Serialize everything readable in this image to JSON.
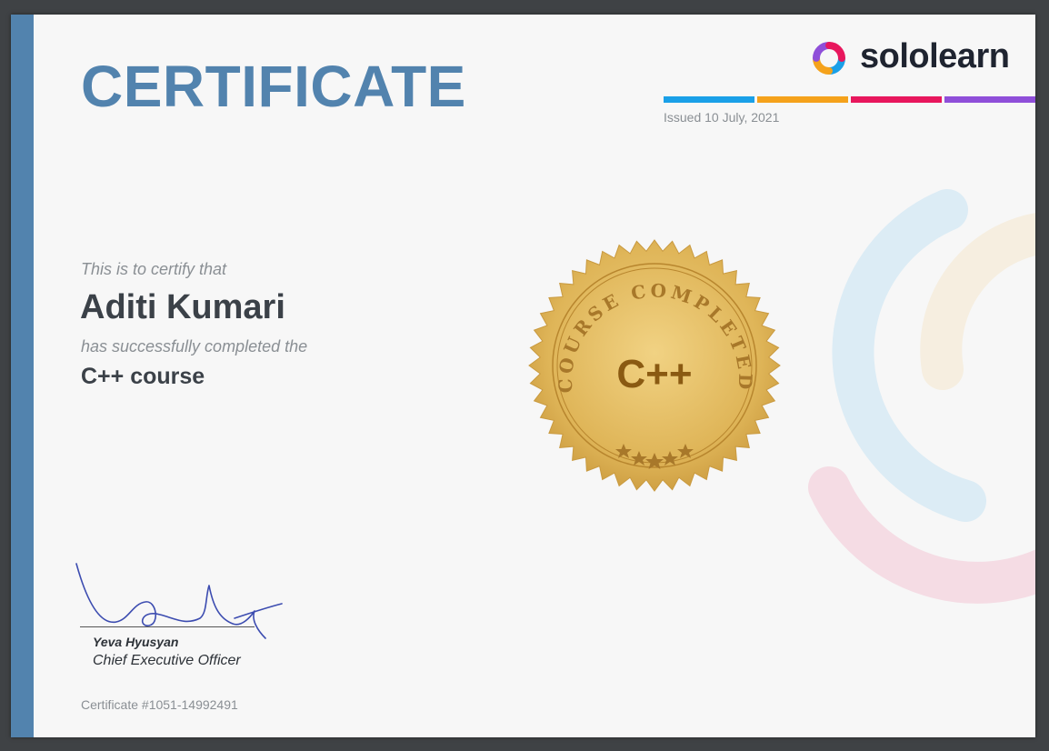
{
  "certificate": {
    "title": "CERTIFICATE",
    "brand": {
      "name": "sololearn",
      "logo_icon": "sololearn-logo-icon",
      "stripe_colors": [
        "#1aa0e8",
        "#f5a21b",
        "#e8175d",
        "#8f4fd9"
      ]
    },
    "issued": "Issued 10 July, 2021",
    "intro": "This is to certify that",
    "recipient": "Aditi Kumari",
    "completion_text": "has successfully completed the",
    "course": "C++ course",
    "seal": {
      "top_text": "COURSE COMPLETED",
      "center": "C++"
    },
    "signer": {
      "name": "Yeva Hyusyan",
      "title": "Chief Executive Officer"
    },
    "certificate_number": "Certificate #1051-14992491",
    "colors": {
      "accent": "#5283ae",
      "gold": "#dfb558",
      "seal_text": "#8a5a12"
    }
  }
}
